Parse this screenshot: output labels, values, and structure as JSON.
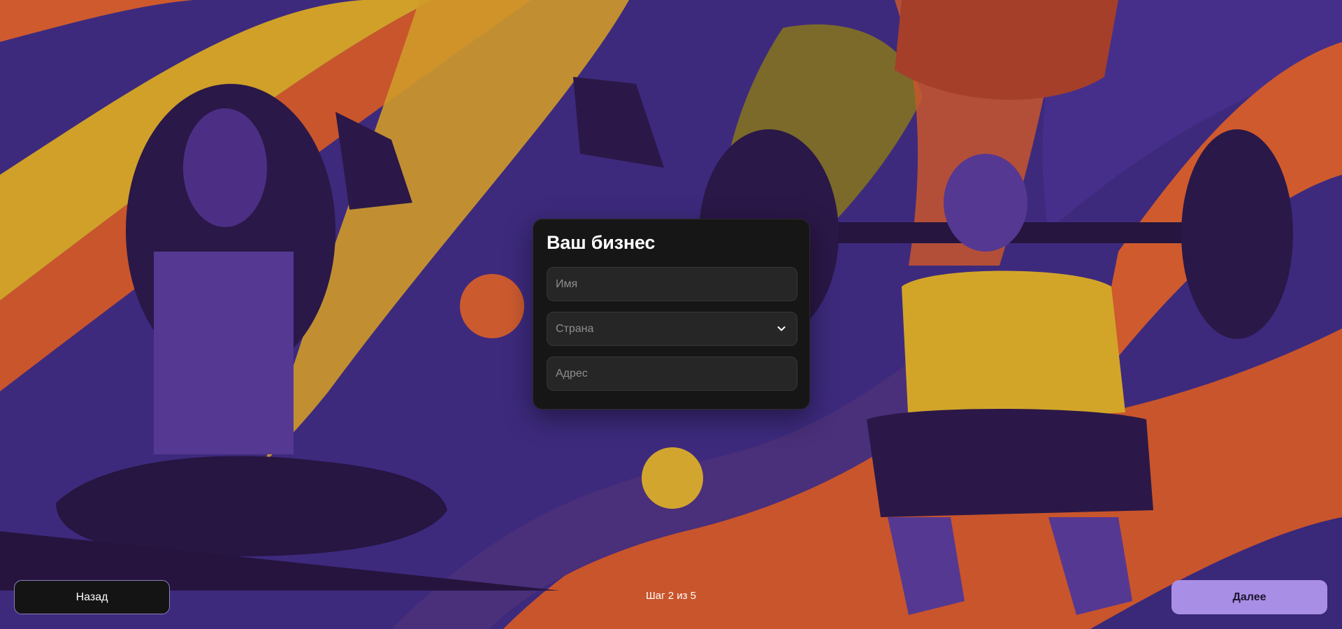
{
  "form": {
    "title": "Ваш бизнес",
    "name_placeholder": "Имя",
    "country_placeholder": "Страна",
    "address_placeholder": "Адрес"
  },
  "footer": {
    "back_label": "Назад",
    "step_text": "Шаг 2 из 5",
    "next_label": "Далее"
  },
  "icons": {
    "dropdown": "chevron-down-icon"
  },
  "colors": {
    "accent": "#a98ee6",
    "card": "#161616",
    "field": "#262626"
  }
}
